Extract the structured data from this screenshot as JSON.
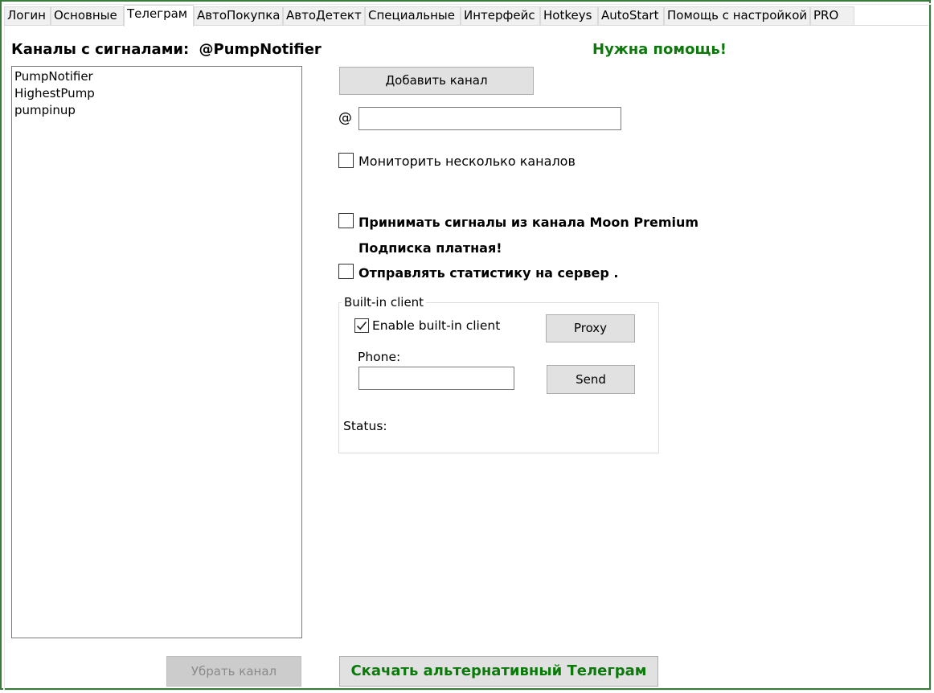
{
  "tabs": [
    {
      "label": "Логин"
    },
    {
      "label": "Основные"
    },
    {
      "label": "Телеграм",
      "active": true
    },
    {
      "label": "АвтоПокупка"
    },
    {
      "label": "АвтоДетект"
    },
    {
      "label": "Специальные"
    },
    {
      "label": "Интерфейс"
    },
    {
      "label": "Hotkeys"
    },
    {
      "label": "AutoStart"
    },
    {
      "label": "Помощь с настройкой"
    },
    {
      "label": "PRO"
    }
  ],
  "channels": {
    "title": "Каналы с сигналами:",
    "official_channel": "@PumpNotifier",
    "items": [
      "PumpNotifier",
      "HighestPump",
      "pumpinup"
    ],
    "remove_button": "Убрать канал"
  },
  "help_link": "Нужна помощь!",
  "add_channel": {
    "button": "Добавить канал",
    "at_symbol": "@",
    "input_value": ""
  },
  "options": {
    "monitor_multiple": {
      "label": "Мониторить несколько каналов",
      "checked": false
    },
    "moon_premium": {
      "label": "Принимать сигналы из канала Moon Premium",
      "checked": false
    },
    "subscription_note": "Подписка платная!",
    "send_stats": {
      "label": "Отправлять статистику на сервер .",
      "checked": false
    }
  },
  "builtin_client": {
    "group_title": "Built-in client",
    "enable": {
      "label": "Enable built-in client",
      "checked": true
    },
    "proxy_button": "Proxy",
    "phone_label": "Phone:",
    "phone_value": "",
    "send_button": "Send",
    "status_label": "Status:"
  },
  "download_button": "Скачать альтернативный Телеграм",
  "colors": {
    "accent_green": "#0b7a0b",
    "frame_green": "#3a7a3a"
  }
}
